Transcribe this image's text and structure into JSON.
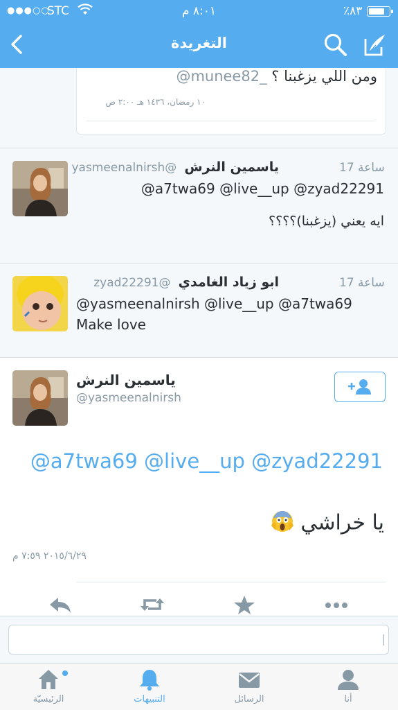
{
  "status_bar": {
    "signal": "●●●○○",
    "carrier": "STC",
    "time": "٨:٠١ م",
    "battery_pct": "٪٨٣",
    "battery_level": 0.83
  },
  "nav": {
    "title": "التغريدة"
  },
  "quoted": {
    "mention": "@munee82_",
    "text": "ومن اللي يزغبنا ؟",
    "time": "١٠ رمضان، ١٤٣٦ هـ ٢:٠٠ ص"
  },
  "replies": [
    {
      "name": "ياسمين النرش",
      "handle": "@yasmeenalnirsh",
      "age": "17 ساعة",
      "mentions": "@a7twa69 @live__up @zyad22291",
      "text": "ايه يعني (يزغبنا)؟؟؟؟"
    },
    {
      "name": "ابو زياد الغامدي",
      "handle": "@zyad22291",
      "age": "17 ساعة",
      "mentions": "@yasmeenalnirsh @live__up @a7twa69",
      "text": "Make love"
    }
  ],
  "tweet": {
    "name": "ياسمين النرش",
    "handle": "@yasmeenalnirsh",
    "mentions": "@a7twa69 @live__up @zyad22291",
    "text": "يا خراشي",
    "date": "٢٠١٥/٦/٢٩ ٧:٥٩ م"
  },
  "reply_box": {
    "placeholder": ""
  },
  "tabs": [
    {
      "label": "الرئيسيّة",
      "icon": "home-icon",
      "active": false
    },
    {
      "label": "التنبيهات",
      "icon": "bell-icon",
      "active": true
    },
    {
      "label": "الرسائل",
      "icon": "envelope-icon",
      "active": false
    },
    {
      "label": "أنا",
      "icon": "person-icon",
      "active": false
    }
  ],
  "colors": {
    "brand": "#55acee",
    "muted": "#8899a6"
  }
}
